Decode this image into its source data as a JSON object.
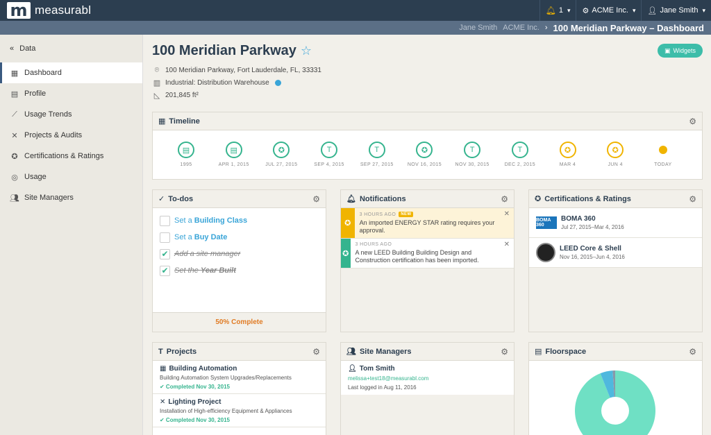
{
  "app": {
    "brand": "measurabl"
  },
  "topbar": {
    "notif_count": "1",
    "org": "ACME Inc.",
    "user": "Jane Smith"
  },
  "breadcrumb": {
    "user": "Jane Smith",
    "org": "ACME Inc.",
    "current": "100 Meridian Parkway – Dashboard"
  },
  "sidebar": {
    "back": "Data",
    "items": [
      {
        "label": "Dashboard",
        "icon": "chart-icon"
      },
      {
        "label": "Profile",
        "icon": "building-icon"
      },
      {
        "label": "Usage Trends",
        "icon": "trend-icon"
      },
      {
        "label": "Projects & Audits",
        "icon": "tools-icon"
      },
      {
        "label": "Certifications & Ratings",
        "icon": "award-icon"
      },
      {
        "label": "Usage",
        "icon": "globe-icon"
      },
      {
        "label": "Site Managers",
        "icon": "users-icon"
      }
    ]
  },
  "property": {
    "title": "100 Meridian Parkway",
    "address": "100 Meridian Parkway, Fort Lauderdale, FL, 33331",
    "type": "Industrial: Distribution Warehouse",
    "area": "201,845 ft²",
    "widgets_label": "Widgets"
  },
  "timeline": {
    "title": "Timeline",
    "nodes": [
      {
        "label": "1995",
        "kind": "building"
      },
      {
        "label": "APR 1, 2015",
        "kind": "building"
      },
      {
        "label": "JUL 27, 2015",
        "kind": "award"
      },
      {
        "label": "SEP 4, 2015",
        "kind": "tool"
      },
      {
        "label": "SEP 27, 2015",
        "kind": "tool"
      },
      {
        "label": "NOV 16, 2015",
        "kind": "award"
      },
      {
        "label": "NOV 30, 2015",
        "kind": "tool"
      },
      {
        "label": "DEC 2, 2015",
        "kind": "tool"
      },
      {
        "label": "MAR 4",
        "kind": "award-gold"
      },
      {
        "label": "JUN 4",
        "kind": "award-gold"
      },
      {
        "label": "TODAY",
        "kind": "today"
      }
    ]
  },
  "todos": {
    "title": "To-dos",
    "items": [
      {
        "prefix": "Set a ",
        "link": "Building Class",
        "done": false
      },
      {
        "prefix": "Set a ",
        "link": "Buy Date",
        "done": false
      },
      {
        "prefix": "Add a site manager",
        "link": "",
        "done": true
      },
      {
        "prefix": "Set the ",
        "link": "Year Built",
        "done": true
      }
    ],
    "footer": "50% Complete"
  },
  "notifications": {
    "title": "Notifications",
    "items": [
      {
        "time": "3 HOURS AGO",
        "badge": "NEW",
        "text": "An imported ENERGY STAR rating requires your approval."
      },
      {
        "time": "3 HOURS AGO",
        "badge": "",
        "text": "A new LEED Building Building Design and Construction certification has been imported."
      }
    ]
  },
  "certifications": {
    "title": "Certifications & Ratings",
    "items": [
      {
        "name": "BOMA 360",
        "dates": "Jul 27, 2015–Mar 4, 2016",
        "logo_text": "BOMA 360"
      },
      {
        "name": "LEED Core & Shell",
        "dates": "Nov 16, 2015–Jun 4, 2016"
      }
    ]
  },
  "projects": {
    "title": "Projects",
    "items": [
      {
        "name": "Building Automation",
        "desc": "Building Automation System Upgrades/Replacements",
        "status": "✔ Completed Nov 30, 2015"
      },
      {
        "name": "Lighting Project",
        "desc": "Installation of High-efficiency Equipment & Appliances",
        "status": "✔ Completed Nov 30, 2015"
      }
    ]
  },
  "managers": {
    "title": "Site Managers",
    "items": [
      {
        "name": "Tom Smith",
        "email": "melissa+test18@measurabl.com",
        "seen": "Last logged in Aug 11, 2016"
      }
    ]
  },
  "floorspace": {
    "title": "Floorspace",
    "chart_data": {
      "type": "pie",
      "slices": [
        {
          "value": 0.94,
          "color": "#6fe0c4"
        },
        {
          "value": 0.05,
          "color": "#4fb8de"
        },
        {
          "value": 0.01,
          "color": "#8899aa"
        }
      ]
    }
  }
}
